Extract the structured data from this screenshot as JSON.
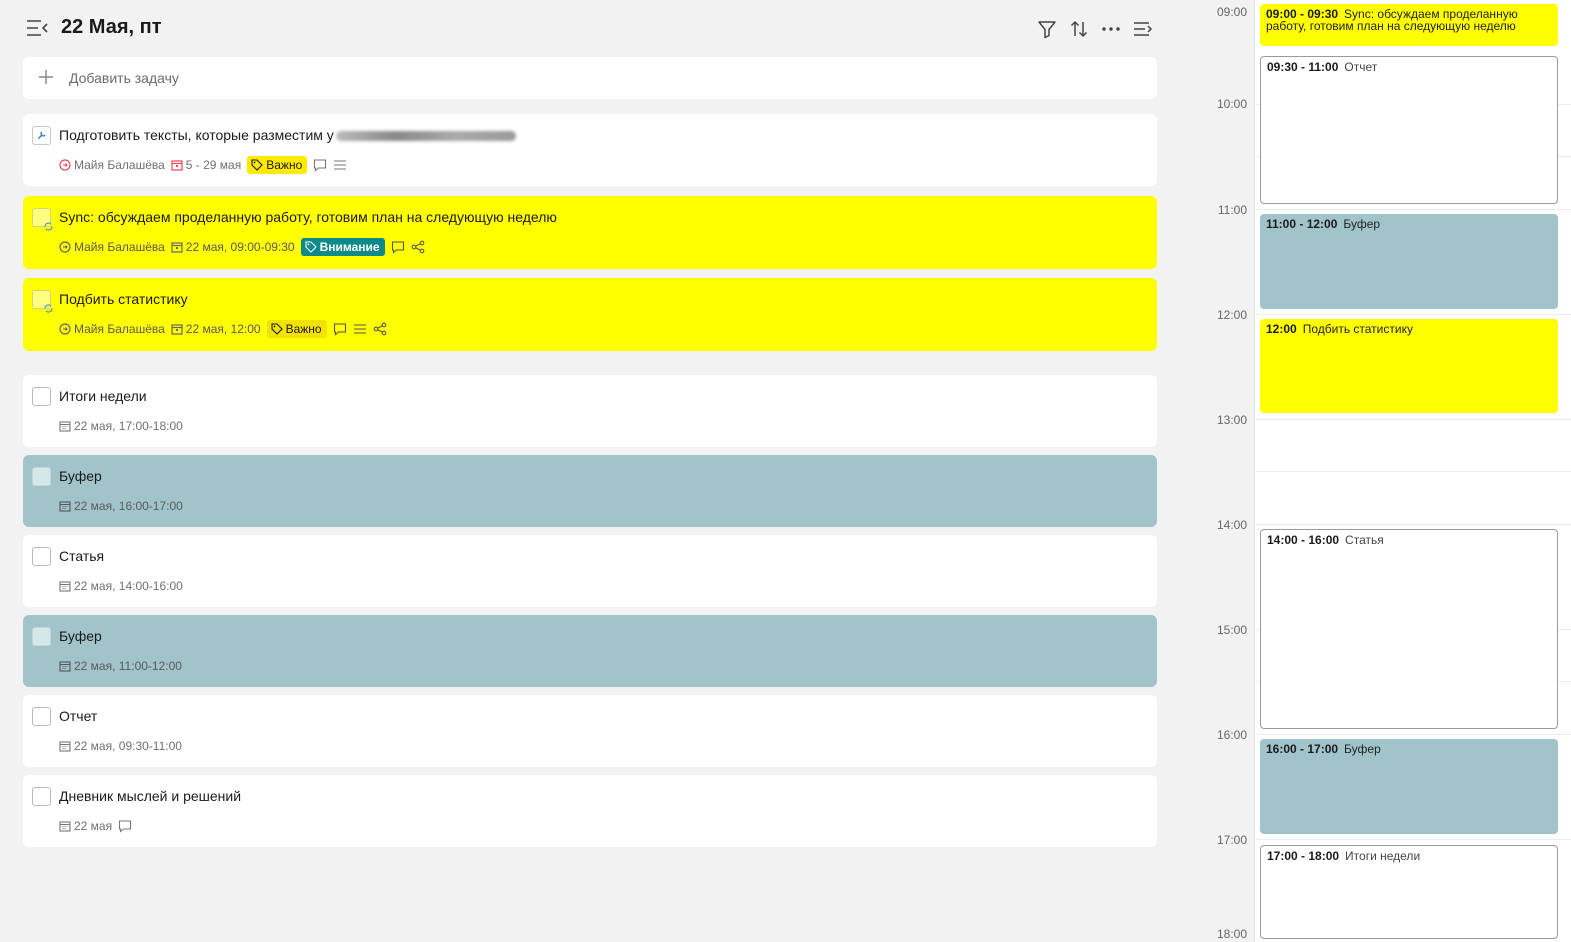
{
  "header": {
    "title": "22 Мая, пт",
    "tools": [
      "filter-icon",
      "sort-icon",
      "more-icon",
      "collapse-panel-icon"
    ]
  },
  "add_task": {
    "label": "Добавить задачу"
  },
  "tasks": [
    {
      "title": "Подготовить тексты, которые разместим у",
      "assignee": "Майя Балашёва",
      "date": "5 - 29 мая",
      "tag": "Важно",
      "style": "white"
    },
    {
      "title": "Sync: обсуждаем проделанную работу, готовим план на следующую неделю",
      "assignee": "Майя Балашёва",
      "date": "22 мая, 09:00-09:30",
      "tag": "Внимание",
      "style": "yellow"
    },
    {
      "title": "Подбить статистику",
      "assignee": "Майя Балашёва",
      "date": "22 мая, 12:00",
      "tag": "Важно",
      "style": "yellow"
    },
    {
      "title": "Итоги недели",
      "date": "22 мая, 17:00-18:00",
      "style": "white"
    },
    {
      "title": "Буфер",
      "date": "22 мая, 16:00-17:00",
      "style": "teal"
    },
    {
      "title": "Статья",
      "date": "22 мая, 14:00-16:00",
      "style": "white"
    },
    {
      "title": "Буфер",
      "date": "22 мая, 11:00-12:00",
      "style": "teal"
    },
    {
      "title": "Отчет",
      "date": "22 мая, 09:30-11:00",
      "style": "white"
    },
    {
      "title": "Дневник мыслей и решений",
      "date": "22 мая",
      "style": "white"
    }
  ],
  "calendar": {
    "hours": [
      "09:00",
      "10:00",
      "11:00",
      "12:00",
      "13:00",
      "14:00",
      "15:00",
      "16:00",
      "17:00",
      "18:00"
    ],
    "events": [
      {
        "time": "09:00 - 09:30",
        "name": "Sync: обсуждаем проделанную работу, готовим план на следующую неделю",
        "style": "yellow"
      },
      {
        "time": "09:30 - 11:00",
        "name": "Отчет",
        "style": "white"
      },
      {
        "time": "11:00 - 12:00",
        "name": "Буфер",
        "style": "teal"
      },
      {
        "time": "12:00",
        "name": "Подбить статистику",
        "style": "yellow"
      },
      {
        "time": "14:00 - 16:00",
        "name": "Статья",
        "style": "white"
      },
      {
        "time": "16:00 - 17:00",
        "name": "Буфер",
        "style": "teal"
      },
      {
        "time": "17:00 - 18:00",
        "name": "Итоги недели",
        "style": "white"
      }
    ]
  },
  "colors": {
    "yellow": "#ffff00",
    "teal": "#a0c4ca",
    "tag_important": "#ffeb00",
    "tag_attention": "#0e8a8a"
  }
}
